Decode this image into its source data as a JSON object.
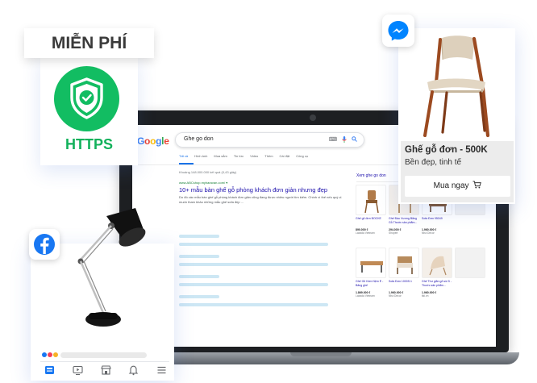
{
  "https_card": {
    "badge_text": "MIỄN PHÍ",
    "label": "HTTPS"
  },
  "messenger_card": {
    "product_title": "Ghế gỗ đơn - 500K",
    "product_subtitle": "Bền đẹp, tinh tế",
    "buy_label": "Mua ngay"
  },
  "google": {
    "logo": "Google",
    "query": "Ghe go don",
    "tabs": [
      "Tất cả",
      "Hình ảnh",
      "Mua sắm",
      "Tin tức",
      "Video",
      "Thêm",
      "Cài đặt",
      "Công cụ"
    ],
    "stats": "Khoảng 148.000.000 kết quả (0,43 giây)",
    "result": {
      "url": "www.ABCshop.myharavan.com/ ▾",
      "title": "10+ mẫu bàn ghế gỗ phòng khách đơn giản nhưng đẹp",
      "snippet": "Do đó các mẫu bàn ghế gỗ phòng khách đơn giản cũng đang được nhiều người tìm kiếm. Chính vì thế nếu quý vị muốn tham khảo những mẫu ghế sofa đẹp ..."
    },
    "shopping_title": "Xem ghe go don",
    "products": [
      {
        "name": "Ghế gỗ đơn BOCKE",
        "price": "890.000 ₫",
        "store": "Lazada Vietnam"
      },
      {
        "name": "Ghế Đầu Vương Bằng Gỗ Thước sản phẩm...",
        "price": "294.000 ₫",
        "store": "Shopee"
      },
      {
        "name": "Sofa Đơn 95049",
        "price": "1.960.000 ₫",
        "store": "Nhà Decor"
      },
      {
        "name": "",
        "price": "",
        "store": ""
      },
      {
        "name": "Ghế Gỗ Kèm Nệm Ê - Băng ghế",
        "price": "1.869.000 ₫",
        "store": "Lazada Vietnam"
      },
      {
        "name": "Sofa Đơn 1000S.1",
        "price": "1.960.000 ₫",
        "store": "Nhà Decor"
      },
      {
        "name": "Ghế Thư giãn gỗ sồi 5 - Thước sản phẩm...",
        "price": "1.960.000 ₫",
        "store": "tiki.vn"
      },
      {
        "name": "",
        "price": "",
        "store": ""
      }
    ]
  },
  "colors": {
    "https_green": "#12bd62",
    "facebook_blue": "#1877f2",
    "messenger_blue": "#0084ff",
    "laptop_dark": "#1d1f22"
  },
  "icons": [
    "shield-check-icon",
    "facebook-icon",
    "messenger-icon",
    "cart-icon",
    "mic-icon",
    "camera-icon",
    "search-icon"
  ]
}
